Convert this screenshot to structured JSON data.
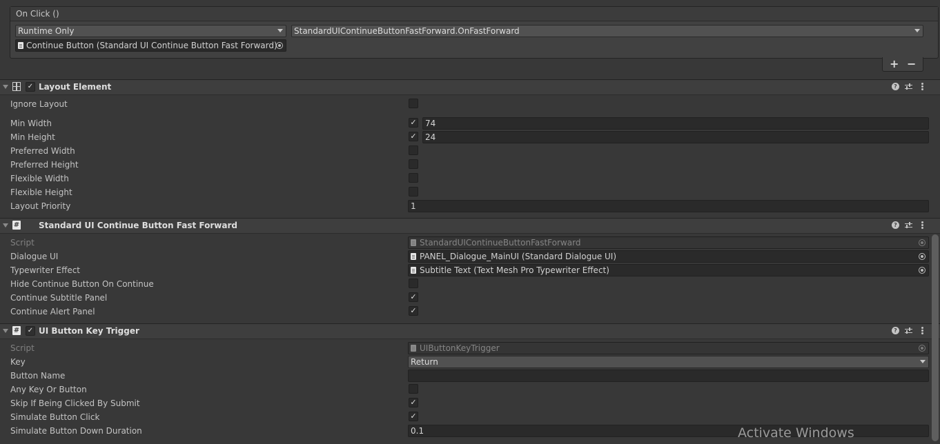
{
  "onclick": {
    "title": "On Click ()",
    "runtime_dropdown": "Runtime Only",
    "function_dropdown": "StandardUIContinueButtonFastForward.OnFastForward",
    "object_field": "Continue Button (Standard UI Continue Button Fast Forward)",
    "add_label": "+",
    "remove_label": "−"
  },
  "layout_element": {
    "title": "Layout Element",
    "enabled": true,
    "rows": {
      "ignore_layout": {
        "label": "Ignore Layout",
        "checked": false
      },
      "min_width": {
        "label": "Min Width",
        "checked": true,
        "value": "74"
      },
      "min_height": {
        "label": "Min Height",
        "checked": true,
        "value": "24"
      },
      "preferred_width": {
        "label": "Preferred Width",
        "checked": false
      },
      "preferred_height": {
        "label": "Preferred Height",
        "checked": false
      },
      "flexible_width": {
        "label": "Flexible Width",
        "checked": false
      },
      "flexible_height": {
        "label": "Flexible Height",
        "checked": false
      },
      "layout_priority": {
        "label": "Layout Priority",
        "value": "1"
      }
    }
  },
  "fast_forward": {
    "title": "Standard UI Continue Button Fast Forward",
    "rows": {
      "script": {
        "label": "Script",
        "value": "StandardUIContinueButtonFastForward"
      },
      "dialogue_ui": {
        "label": "Dialogue UI",
        "value": "PANEL_Dialogue_MainUI (Standard Dialogue UI)"
      },
      "typewriter_effect": {
        "label": "Typewriter Effect",
        "value": "Subtitle Text (Text Mesh Pro Typewriter Effect)"
      },
      "hide_continue": {
        "label": "Hide Continue Button On Continue",
        "checked": false
      },
      "continue_subtitle": {
        "label": "Continue Subtitle Panel",
        "checked": true
      },
      "continue_alert": {
        "label": "Continue Alert Panel",
        "checked": true
      }
    }
  },
  "key_trigger": {
    "title": "UI Button Key Trigger",
    "enabled": true,
    "rows": {
      "script": {
        "label": "Script",
        "value": "UIButtonKeyTrigger"
      },
      "key": {
        "label": "Key",
        "value": "Return"
      },
      "button_name": {
        "label": "Button Name",
        "value": ""
      },
      "any_key": {
        "label": "Any Key Or Button",
        "checked": false
      },
      "skip_submit": {
        "label": "Skip If Being Clicked By Submit",
        "checked": true
      },
      "simulate_click": {
        "label": "Simulate Button Click",
        "checked": true
      },
      "simulate_duration": {
        "label": "Simulate Button Down Duration",
        "value": "0.1"
      }
    }
  },
  "icons": {
    "help": "help-icon",
    "presets": "presets-icon",
    "menu": "kebab-menu-icon",
    "script": "script-hash-icon",
    "layout": "layout-element-icon"
  },
  "checkmark": "✓",
  "watermark": "Activate Windows"
}
